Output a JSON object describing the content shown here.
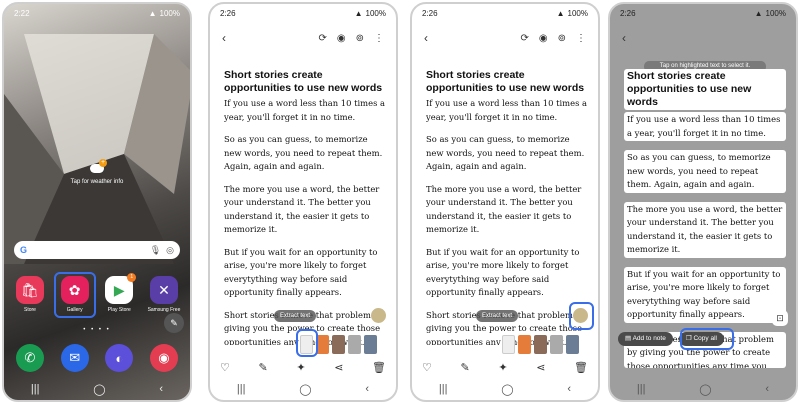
{
  "phones": [
    {
      "time": "2:22",
      "battery": "100%"
    },
    {
      "time": "2:26",
      "battery": "100%"
    },
    {
      "time": "2:26",
      "battery": "100%"
    },
    {
      "time": "2:26",
      "battery": "100%"
    }
  ],
  "home": {
    "weather": "Tap for weather info",
    "apps": [
      "Store",
      "Gallery",
      "Play Store",
      "Samsung Free"
    ],
    "play_badge": "1"
  },
  "document": {
    "title": "Short stories create opportunities to use new words",
    "paragraphs": [
      "If you use a word less than 10 times a year, you'll forget it in no time.",
      "So as you can guess, to memorize new words, you need to repeat them. Again, again and again.",
      "The more you use a word, the better your understand it. The better you understand it, the easier it gets to memorize it.",
      "But if you wait for an opportunity to arise, you're more likely to forget everytything way before said opportunity finally appears.",
      "Short stories remove that problem by giving you the power to create those opportunities any time you want."
    ]
  },
  "reader": {
    "extract_pill": "Extract text"
  },
  "select": {
    "tap_message": "Tap on highlighted text to select it.",
    "add_to_note": "Add to note",
    "copy_all": "Copy all"
  }
}
